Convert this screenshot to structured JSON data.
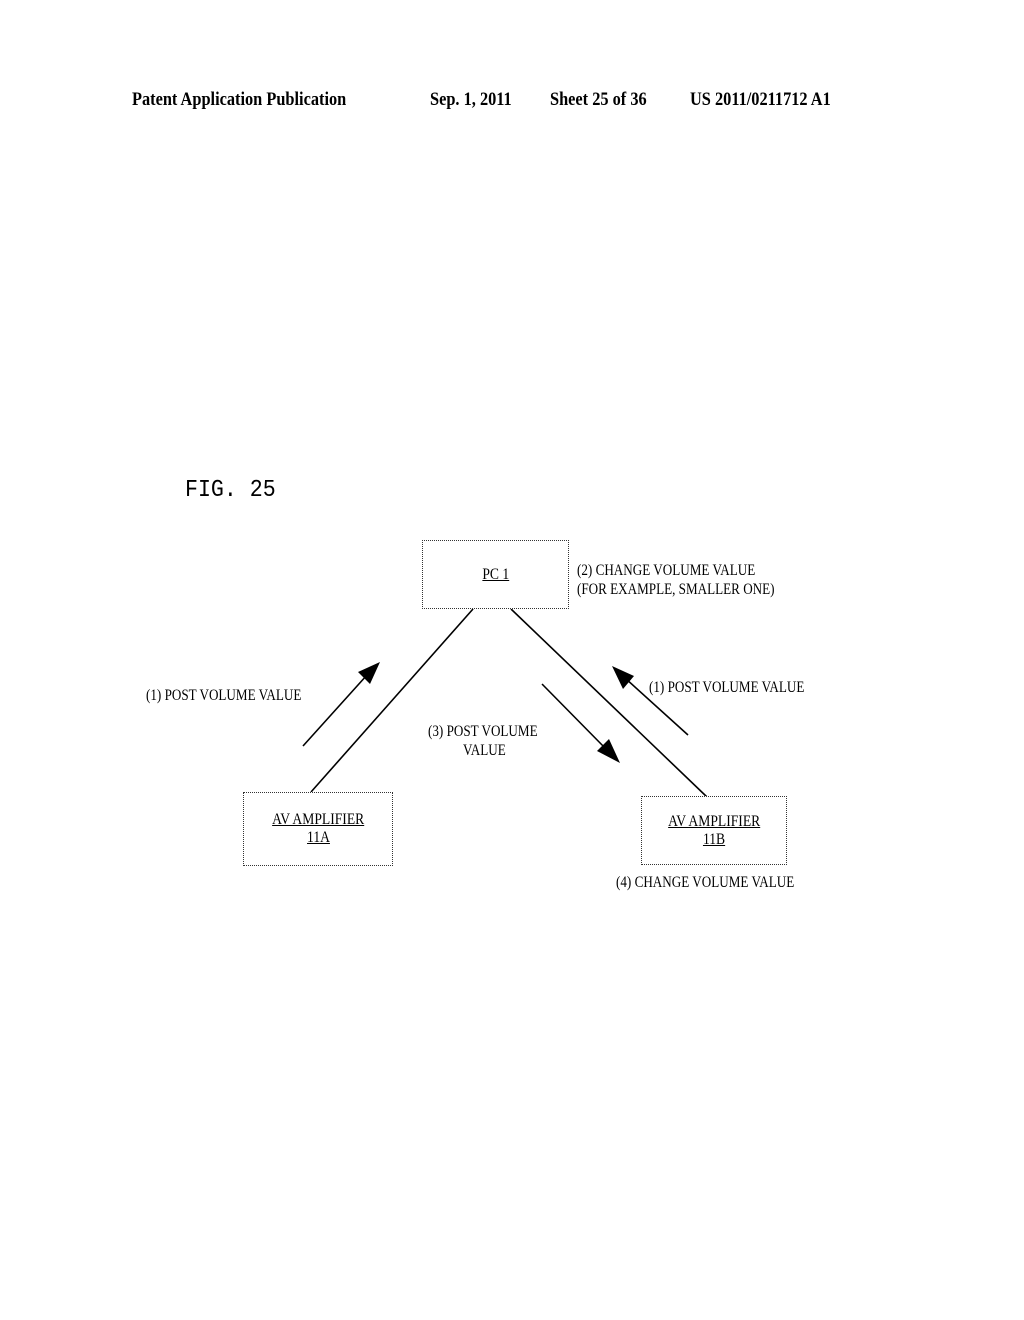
{
  "header": {
    "publication": "Patent Application Publication",
    "date": "Sep. 1, 2011",
    "sheet": "Sheet 25 of 36",
    "number": "US 2011/0211712 A1"
  },
  "figure": {
    "title": "FIG. 25",
    "nodes": {
      "pc": {
        "label": "PC 1"
      },
      "amp_a": {
        "line1": "AV AMPLIFIER",
        "line2": "11A"
      },
      "amp_b": {
        "line1": "AV AMPLIFIER",
        "line2": "11B"
      }
    },
    "labels": {
      "pc_note_line1": "(2) CHANGE VOLUME VALUE",
      "pc_note_line2": "(FOR EXAMPLE, SMALLER ONE)",
      "left_post": "(1) POST VOLUME VALUE",
      "right_post": "(1) POST VOLUME VALUE",
      "mid_post_line1": "(3) POST VOLUME",
      "mid_post_line2": "VALUE",
      "amp_b_note": "(4) CHANGE VOLUME VALUE"
    },
    "edges": [
      {
        "from": "amp_a",
        "to": "pc",
        "arrow": "amp_a → pc",
        "step": "(1)"
      },
      {
        "from": "amp_b",
        "to": "pc",
        "arrow": "amp_b → pc",
        "step": "(1)"
      },
      {
        "from": "pc",
        "to": "amp_b",
        "arrow": "pc → amp_b",
        "step": "(3)"
      }
    ]
  }
}
